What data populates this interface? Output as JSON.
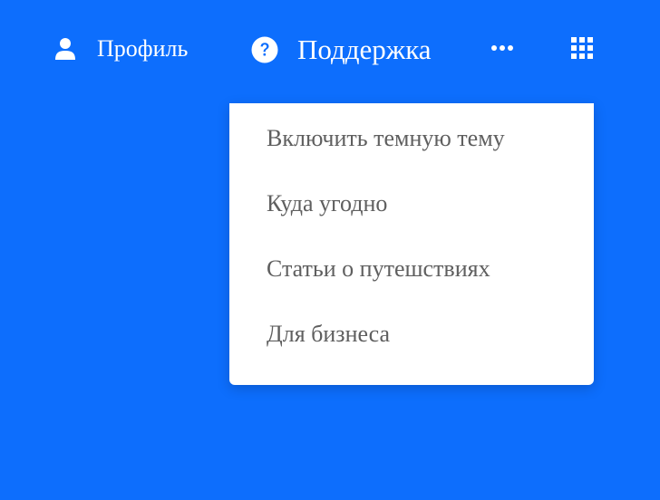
{
  "nav": {
    "profile": {
      "label": "Профиль",
      "icon": "user-icon"
    },
    "support": {
      "label": "Поддержка",
      "icon": "question-circle-icon"
    },
    "more": {
      "icon": "more-horizontal-icon"
    },
    "apps": {
      "icon": "apps-grid-icon"
    }
  },
  "dropdown": {
    "items": [
      {
        "label": "Включить темную тему"
      },
      {
        "label": "Куда угодно"
      },
      {
        "label": "Статьи о путешствиях"
      },
      {
        "label": "Для бизнеса"
      }
    ]
  },
  "colors": {
    "background": "#0D6EFD",
    "menu_background": "#FFFFFF",
    "menu_text": "#5F5F5F",
    "nav_text": "#FFFFFF"
  }
}
